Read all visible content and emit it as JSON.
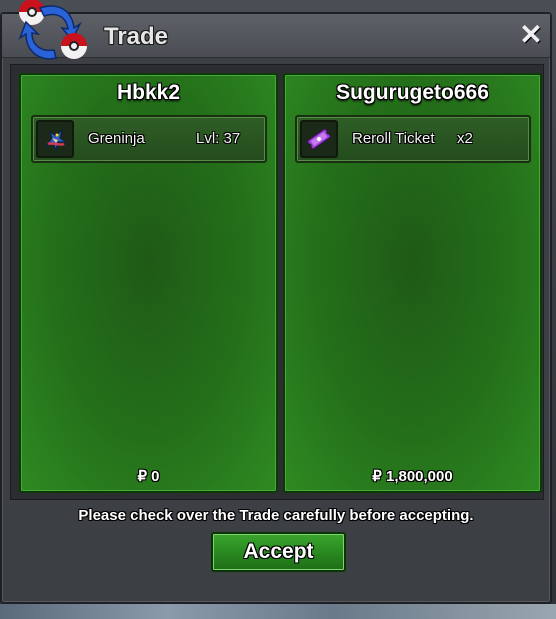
{
  "window": {
    "title": "Trade",
    "close_symbol": "✕",
    "logo_icon": "trade-swap-icon"
  },
  "left_panel": {
    "username": "Hbkk2",
    "items": [
      {
        "name": "Greninja",
        "extra": "Lvl: 37",
        "icon": "greninja-icon"
      }
    ],
    "money": "₽ 0"
  },
  "right_panel": {
    "username": "Sugurugeto666",
    "items": [
      {
        "name": "Reroll Ticket",
        "extra": "x2",
        "icon": "reroll-ticket-icon"
      }
    ],
    "money": "₽ 1,800,000"
  },
  "notice": "Please check over the Trade carefully before accepting.",
  "accept_label": "Accept",
  "colors": {
    "panel_green": "#24701a",
    "accept_green": "#2a8a20",
    "window_bg": "#3c3f44"
  }
}
